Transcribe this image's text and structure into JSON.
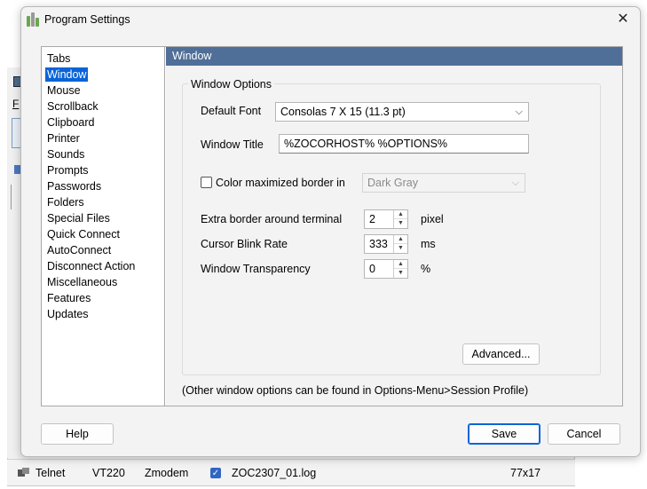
{
  "background_window": {
    "menu_letter": "F",
    "statusbar": {
      "protocol": "Telnet",
      "emulation": "VT220",
      "transfer": "Zmodem",
      "log_file": "ZOC2307_01.log",
      "log_checked": true,
      "size": "77x17"
    }
  },
  "dialog": {
    "title": "Program Settings",
    "close_glyph": "✕",
    "nav_items": [
      {
        "label": "Tabs"
      },
      {
        "label": "Window"
      },
      {
        "label": "Mouse"
      },
      {
        "label": "Scrollback"
      },
      {
        "label": "Clipboard"
      },
      {
        "label": "Printer"
      },
      {
        "label": "Sounds"
      },
      {
        "label": "Prompts"
      },
      {
        "label": "Passwords"
      },
      {
        "label": "Folders"
      },
      {
        "label": "Special Files"
      },
      {
        "label": "Quick Connect"
      },
      {
        "label": "AutoConnect"
      },
      {
        "label": "Disconnect Action"
      },
      {
        "label": "Miscellaneous"
      },
      {
        "label": "Features"
      },
      {
        "label": "Updates"
      }
    ],
    "selected_nav": "Window",
    "content": {
      "header": "Window",
      "group_title": "Window Options",
      "default_font_label": "Default Font",
      "default_font_value": "Consolas  7 X 15 (11.3 pt)",
      "window_title_label": "Window Title",
      "window_title_value": "%ZOCORHOST% %OPTIONS%",
      "color_border_label": "Color maximized border in",
      "color_border_checked": false,
      "color_border_value": "Dark Gray",
      "extra_border_label": "Extra border around terminal",
      "extra_border_value": "2",
      "extra_border_unit": "pixel",
      "blink_rate_label": "Cursor Blink Rate",
      "blink_rate_value": "333",
      "blink_rate_unit": "ms",
      "transparency_label": "Window Transparency",
      "transparency_value": "0",
      "transparency_unit": "%",
      "advanced_button": "Advanced...",
      "footnote": "(Other window options can be found in Options-Menu>Session Profile)"
    },
    "buttons": {
      "help": "Help",
      "save": "Save",
      "cancel": "Cancel"
    },
    "colors": {
      "header_bg": "#4f6f98",
      "selection": "#0a64d8",
      "dialog_bg": "#f3f3f3"
    }
  }
}
